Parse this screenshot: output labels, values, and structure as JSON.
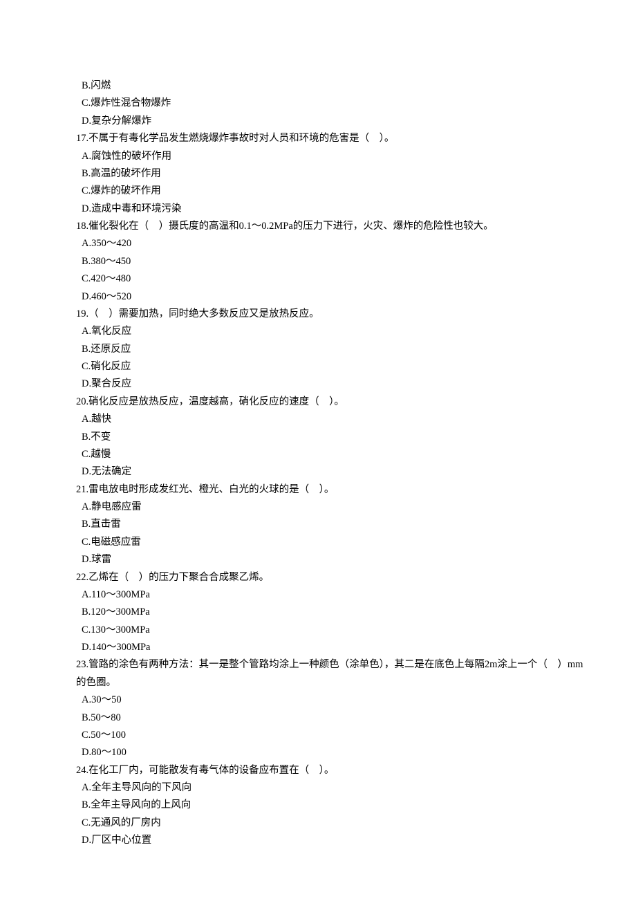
{
  "items": [
    {
      "type": "option",
      "text": "B.闪燃"
    },
    {
      "type": "option",
      "text": "C.爆炸性混合物爆炸"
    },
    {
      "type": "option",
      "text": "D.复杂分解爆炸"
    },
    {
      "type": "question",
      "text": "17.不属于有毒化学品发生燃烧爆炸事故时对人员和环境的危害是（　）。"
    },
    {
      "type": "option",
      "text": "A.腐蚀性的破坏作用"
    },
    {
      "type": "option",
      "text": "B.高温的破坏作用"
    },
    {
      "type": "option",
      "text": "C.爆炸的破坏作用"
    },
    {
      "type": "option",
      "text": "D.造成中毒和环境污染"
    },
    {
      "type": "question",
      "text": "18.催化裂化在（　）摄氏度的高温和0.1～0.2MPa的压力下进行，火灾、爆炸的危险性也较大。"
    },
    {
      "type": "option",
      "text": "A.350～420"
    },
    {
      "type": "option",
      "text": "B.380～450"
    },
    {
      "type": "option",
      "text": "C.420～480"
    },
    {
      "type": "option",
      "text": "D.460～520"
    },
    {
      "type": "question",
      "text": "19.（　）需要加热，同时绝大多数反应又是放热反应。"
    },
    {
      "type": "option",
      "text": "A.氧化反应"
    },
    {
      "type": "option",
      "text": "B.还原反应"
    },
    {
      "type": "option",
      "text": "C.硝化反应"
    },
    {
      "type": "option",
      "text": "D.聚合反应"
    },
    {
      "type": "question",
      "text": "20.硝化反应是放热反应，温度越高，硝化反应的速度（　）。"
    },
    {
      "type": "option",
      "text": "A.越快"
    },
    {
      "type": "option",
      "text": "B.不变"
    },
    {
      "type": "option",
      "text": "C.越慢"
    },
    {
      "type": "option",
      "text": "D.无法确定"
    },
    {
      "type": "question",
      "text": "21.雷电放电时形成发红光、橙光、白光的火球的是（　）。"
    },
    {
      "type": "option",
      "text": "A.静电感应雷"
    },
    {
      "type": "option",
      "text": "B.直击雷"
    },
    {
      "type": "option",
      "text": "C.电磁感应雷"
    },
    {
      "type": "option",
      "text": "D.球雷"
    },
    {
      "type": "question",
      "text": "22.乙烯在（　）的压力下聚合合成聚乙烯。"
    },
    {
      "type": "option",
      "text": "A.110～300MPa"
    },
    {
      "type": "option",
      "text": "B.120～300MPa"
    },
    {
      "type": "option",
      "text": "C.130～300MPa"
    },
    {
      "type": "option",
      "text": "D.140～300MPa"
    },
    {
      "type": "question",
      "text": "23.管路的涂色有两种方法：其一是整个管路均涂上一种颜色（涂单色），其二是在底色上每隔2m涂上一个（　）mm的色圈。"
    },
    {
      "type": "option",
      "text": "A.30～50"
    },
    {
      "type": "option",
      "text": "B.50～80"
    },
    {
      "type": "option",
      "text": "C.50～100"
    },
    {
      "type": "option",
      "text": "D.80～100"
    },
    {
      "type": "question",
      "text": "24.在化工厂内，可能散发有毒气体的设备应布置在（　）。"
    },
    {
      "type": "option",
      "text": "A.全年主导风向的下风向"
    },
    {
      "type": "option",
      "text": "B.全年主导风向的上风向"
    },
    {
      "type": "option",
      "text": "C.无通风的厂房内"
    },
    {
      "type": "option",
      "text": "D.厂区中心位置"
    }
  ]
}
